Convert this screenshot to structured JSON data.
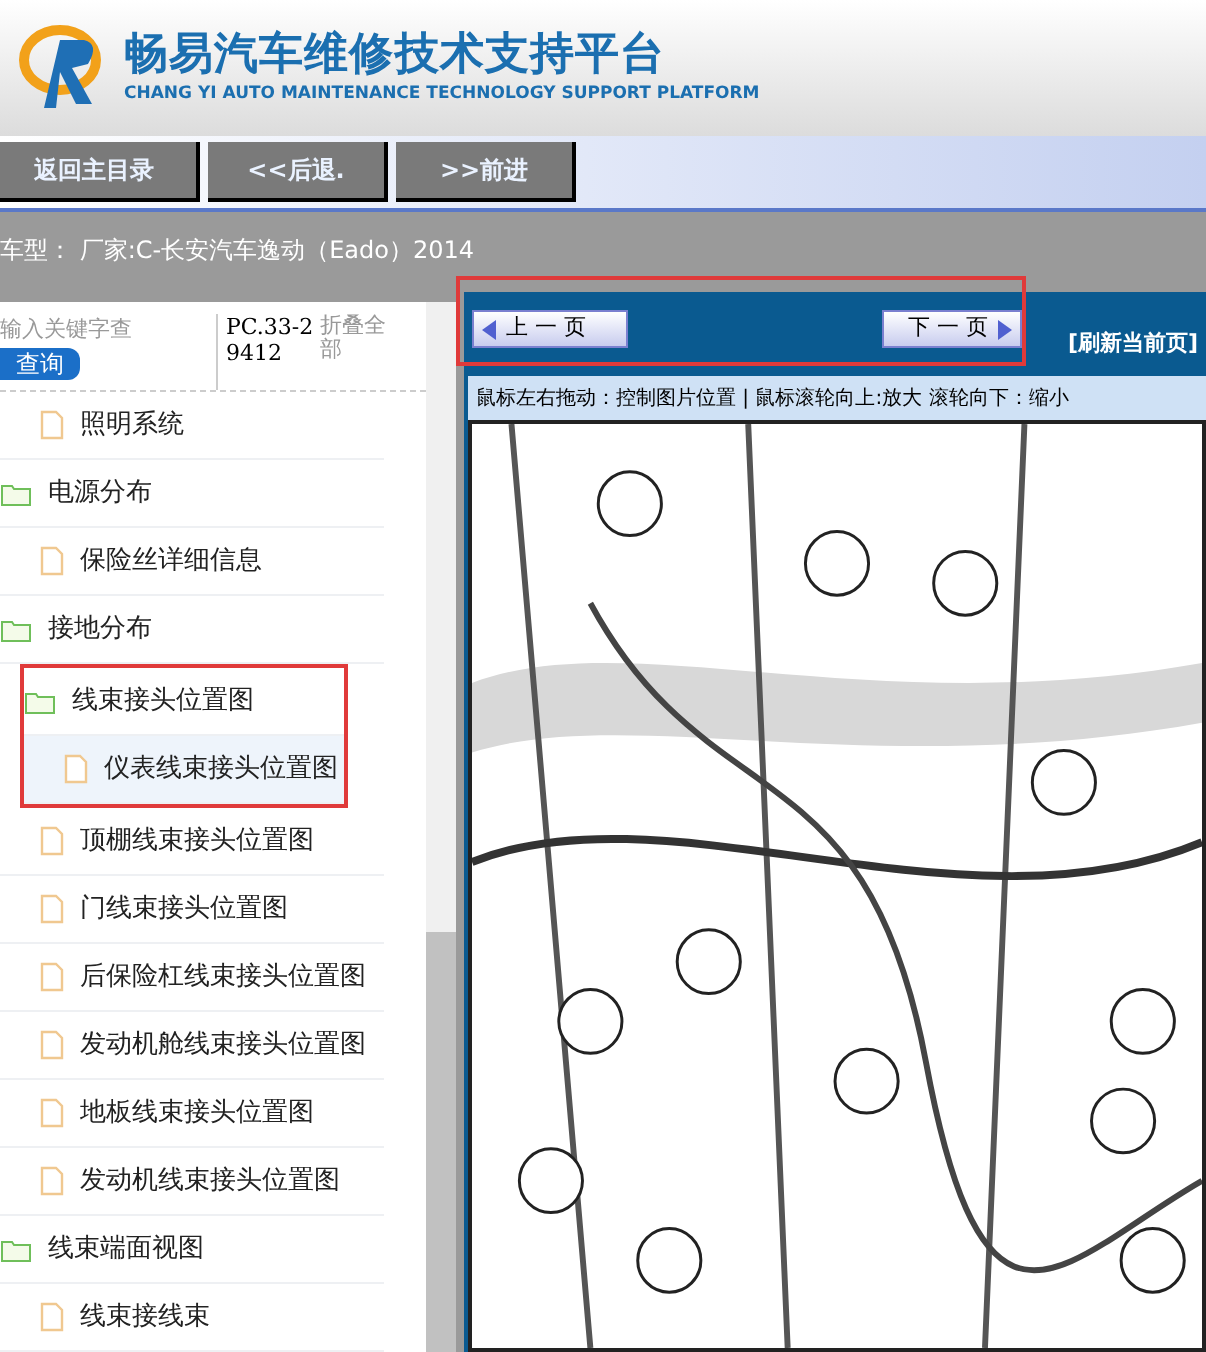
{
  "header": {
    "title": "畅易汽车维修技术支持平台",
    "subtitle": "CHANG YI AUTO MAINTENANCE TECHNOLOGY SUPPORT PLATFORM"
  },
  "nav_buttons": [
    "返回主目录",
    "<<后退.",
    ">>前进"
  ],
  "vehicle": "车型：  厂家:C-长安汽车逸动（Eado）2014",
  "sidebar": {
    "search": {
      "placeholder": "输入关键字查"
    },
    "search_button": "查询",
    "code": "PC.33-29412",
    "collapse_all": "折叠全部",
    "items": [
      {
        "kind": "file",
        "label": "照明系统",
        "selected": false,
        "highlighted": false
      },
      {
        "kind": "folder",
        "label": "电源分布",
        "selected": false,
        "highlighted": false
      },
      {
        "kind": "file",
        "label": "保险丝详细信息",
        "selected": false,
        "highlighted": false
      },
      {
        "kind": "folder",
        "label": "接地分布",
        "selected": false,
        "highlighted": false
      },
      {
        "kind": "folder",
        "label": "线束接头位置图",
        "selected": false,
        "highlighted": true
      },
      {
        "kind": "file",
        "label": "仪表线束接头位置图",
        "selected": true,
        "highlighted": true
      },
      {
        "kind": "file",
        "label": "顶棚线束接头位置图",
        "selected": false,
        "highlighted": false
      },
      {
        "kind": "file",
        "label": "门线束接头位置图",
        "selected": false,
        "highlighted": false
      },
      {
        "kind": "file",
        "label": "后保险杠线束接头位置图",
        "selected": false,
        "highlighted": false
      },
      {
        "kind": "file",
        "label": "发动机舱线束接头位置图",
        "selected": false,
        "highlighted": false
      },
      {
        "kind": "file",
        "label": "地板线束接头位置图",
        "selected": false,
        "highlighted": false
      },
      {
        "kind": "file",
        "label": "发动机线束接头位置图",
        "selected": false,
        "highlighted": false
      },
      {
        "kind": "folder",
        "label": "线束端面视图",
        "selected": false,
        "highlighted": false
      },
      {
        "kind": "file",
        "label": "线束接线束",
        "selected": false,
        "highlighted": false
      }
    ]
  },
  "viewer": {
    "pager_highlighted": true,
    "prev": "上 一 页",
    "next": "下 一 页",
    "refresh": "[刷新当前页]",
    "hint": "鼠标左右拖动：控制图片位置 | 鼠标滚轮向上:放大  滚轮向下：缩小",
    "diagram": {
      "kind": "picture"
    }
  }
}
